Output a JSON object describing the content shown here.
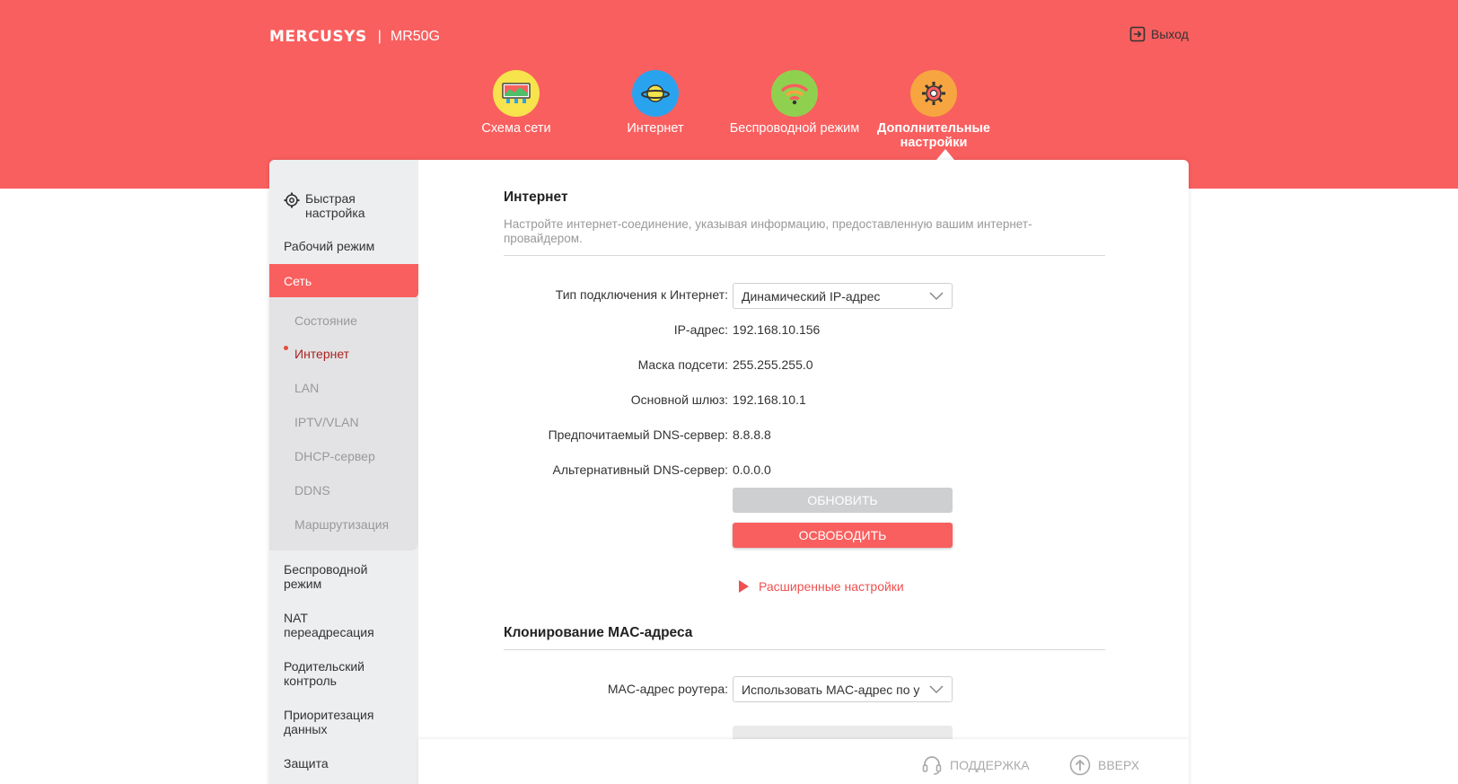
{
  "header": {
    "brand": "MERCUSYS",
    "separator": "|",
    "model": "MR50G",
    "logout_label": "Выход"
  },
  "topnav": {
    "items": [
      {
        "label": "Схема сети",
        "icon": "network-map-icon",
        "color": "#f7e34b"
      },
      {
        "label": "Интернет",
        "icon": "planet-icon",
        "color": "#2aa3ef"
      },
      {
        "label": "Беспроводной режим",
        "icon": "wifi-icon",
        "color": "#8fd14f"
      },
      {
        "label": "Дополнительные настройки",
        "icon": "gear-icon",
        "color": "#f7a540"
      }
    ],
    "active_index": 3
  },
  "sidebar": {
    "quick_setup": "Быстрая настройка",
    "work_mode": "Рабочий режим",
    "network": "Сеть",
    "sub_items": [
      "Состояние",
      "Интернет",
      "LAN",
      "IPTV/VLAN",
      "DHCP-сервер",
      "DDNS",
      "Маршрутизация"
    ],
    "active_sub": "Интернет",
    "wireless": "Беспроводной режим",
    "nat": "NAT переадресация",
    "parental": "Родительский контроль",
    "qos": "Приоритезация данных",
    "security": "Защита"
  },
  "internet": {
    "title": "Интернет",
    "description": "Настройте интернет-соединение, указывая информацию, предоставленную вашим интернет-провайдером.",
    "conn_type_label": "Тип подключения к Интернет:",
    "conn_type_value": "Динамический IP-адрес",
    "ip_label": "IP-адрес:",
    "ip_value": "192.168.10.156",
    "mask_label": "Маска подсети:",
    "mask_value": "255.255.255.0",
    "gateway_label": "Основной шлюз:",
    "gateway_value": "192.168.10.1",
    "dns1_label": "Предпочитаемый DNS-сервер:",
    "dns1_value": "8.8.8.8",
    "dns2_label": "Альтернативный DNS-сервер:",
    "dns2_value": "0.0.0.0",
    "renew_button": "ОБНОВИТЬ",
    "release_button": "ОСВОБОДИТЬ",
    "advanced_link": "Расширенные настройки"
  },
  "mac_clone": {
    "title": "Клонирование MAC-адреса",
    "router_mac_label": "MAC-адрес роутера:",
    "router_mac_value": "Использовать MAC-адрес по у"
  },
  "footer": {
    "support": "ПОДДЕРЖКА",
    "top": "ВВЕРХ"
  },
  "colors": {
    "accent": "#f95f5f",
    "sidebar_bg": "#eceeef"
  }
}
